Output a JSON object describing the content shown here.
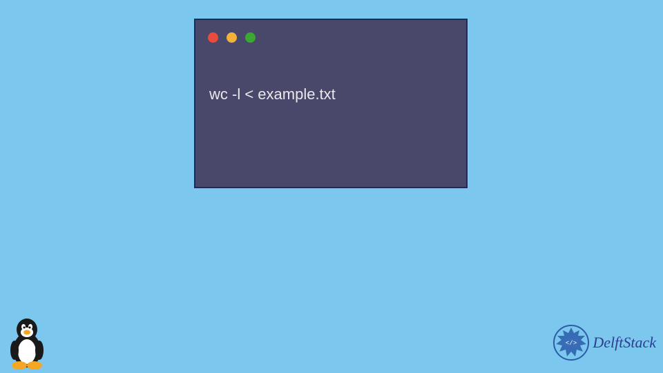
{
  "terminal": {
    "command": "wc -l < example.txt",
    "titlebar": {
      "dots": {
        "red": "close-icon",
        "yellow": "minimize-icon",
        "green": "maximize-icon"
      }
    }
  },
  "branding": {
    "tux": "linux-tux-icon",
    "delftstack_label": "DelftStack"
  },
  "colors": {
    "background": "#7cc7ee",
    "terminal_bg": "#49486a",
    "terminal_border": "#1a2b5c",
    "terminal_text": "#e8e8ec",
    "brand_text": "#2a3d8f"
  }
}
